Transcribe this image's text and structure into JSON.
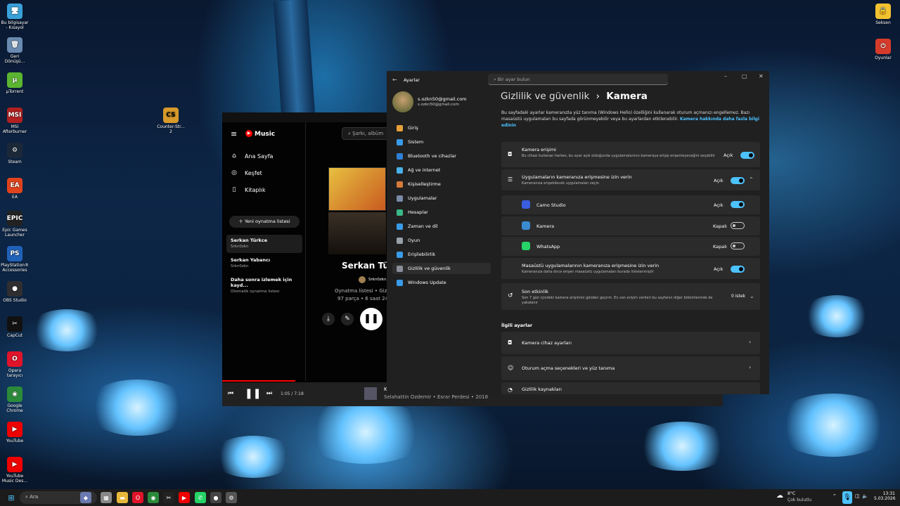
{
  "desktop": {
    "icons": [
      {
        "label": "Bu bilgisayar - Kısayol",
        "glyph": "🖥",
        "color": "#3aa0d8"
      },
      {
        "label": "Geri Dönüşü...",
        "glyph": "🗑",
        "color": "#6a8ab0"
      },
      {
        "label": "µTorrent",
        "glyph": "µ",
        "color": "#5bb531"
      },
      {
        "label": "MSI Afterburner",
        "glyph": "MSI",
        "color": "#b02020"
      },
      {
        "label": "Steam",
        "glyph": "⚙",
        "color": "#1b2838"
      },
      {
        "label": "EA",
        "glyph": "EA",
        "color": "#e0431c"
      },
      {
        "label": "Epic Games Launcher",
        "glyph": "EPIC",
        "color": "#222"
      },
      {
        "label": "PlayStation® Accessories",
        "glyph": "PS",
        "color": "#2062b8"
      },
      {
        "label": "OBS Studio",
        "glyph": "●",
        "color": "#302e31"
      },
      {
        "label": "CapCut",
        "glyph": "✂",
        "color": "#111"
      },
      {
        "label": "Opera tarayıcı",
        "glyph": "O",
        "color": "#e0132a"
      },
      {
        "label": "Google Chrome",
        "glyph": "◉",
        "color": "#2a8a3a"
      },
      {
        "label": "YouTube",
        "glyph": "▶",
        "color": "#e00"
      },
      {
        "label": "YouTube Music Des...",
        "glyph": "▶",
        "color": "#e00"
      }
    ],
    "cs_icon": {
      "label": "Counter-Str... 2",
      "glyph": "CS"
    },
    "right_icons": [
      {
        "label": "Seksen",
        "glyph": "🔒"
      },
      {
        "label": "Oyunlar",
        "glyph": "⏻"
      }
    ]
  },
  "music": {
    "app": "Music",
    "search_placeholder": "Şarkı, albüm",
    "nav": [
      {
        "label": "Ana Sayfa",
        "icon": "home-icon",
        "glyph": "⌂"
      },
      {
        "label": "Keşfet",
        "icon": "compass-icon",
        "glyph": "◎"
      },
      {
        "label": "Kitaplık",
        "icon": "library-icon",
        "glyph": "▯"
      }
    ],
    "new_playlist": "Yeni oynatma listesi",
    "playlists": [
      {
        "title": "Serkan Türkce",
        "sub": "Srkn0zkn"
      },
      {
        "title": "Serkan Yabancı",
        "sub": "Srkn0zkn"
      },
      {
        "title": "Daha sonra izlemek için kayd...",
        "sub": "Otomatik oynatma listesi"
      }
    ],
    "album_title": "Serkan Tür",
    "owner": "Srkn0zkn",
    "meta1": "Oynatma listesi • Giz",
    "meta2": "97 parça • 6 saat 24",
    "player_time": "1:05 / 7:18",
    "player_track": "Selahattin Özdemir • Esrar Perdesi • 2018",
    "player_track_short": "K"
  },
  "settings": {
    "window_title": "Ayarlar",
    "search_placeholder": "Bir ayar bulun",
    "user_email": "s.ozkn50@gmail.com",
    "user_email2": "s.ozkn50@gmail.com",
    "nav": [
      {
        "label": "Giriş",
        "color": "#e8a13a"
      },
      {
        "label": "Sistem",
        "color": "#3a9be8"
      },
      {
        "label": "Bluetooth ve cihazlar",
        "color": "#2f7fd6"
      },
      {
        "label": "Ağ ve internet",
        "color": "#4ab0e8"
      },
      {
        "label": "Kişiselleştirme",
        "color": "#d57a3a"
      },
      {
        "label": "Uygulamalar",
        "color": "#7a8aa8"
      },
      {
        "label": "Hesaplar",
        "color": "#3ab88a"
      },
      {
        "label": "Zaman ve dil",
        "color": "#3a9be8"
      },
      {
        "label": "Oyun",
        "color": "#9aa0aa"
      },
      {
        "label": "Erişilebilirlik",
        "color": "#3a9be8"
      },
      {
        "label": "Gizlilik ve güvenlik",
        "color": "#8a8f99"
      },
      {
        "label": "Windows Update",
        "color": "#3a9be8"
      }
    ],
    "breadcrumb_parent": "Gizlilik ve güvenlik",
    "breadcrumb_sep": "›",
    "breadcrumb_current": "Kamera",
    "description": "Bu sayfadaki ayarlar kameranızla yüz tanıma (Windows Hello) özelliğini kullanarak oturum açmanızı engellemez. Bazı masaüstü uygulamaları bu sayfada görünmeyebilir veya bu ayarlardan etkilenebilir.",
    "description_link": "Kamera hakkında daha fazla bilgi edinin",
    "camera_access": {
      "title": "Kamera erişimi",
      "sub": "Bu cihazı kullanan herkes, bu ayar açık olduğunda uygulamalarının kameraya erişip erişemeyeceğini seçebilir",
      "state": "Açık"
    },
    "apps_access": {
      "title": "Uygulamaların kameranıza erişmesine izin verin",
      "sub": "Kameranıza erişebilecek uygulamaları seçin",
      "state": "Açık"
    },
    "apps": [
      {
        "name": "Camo Studio",
        "state": "Açık",
        "on": true,
        "color": "#3a5de0"
      },
      {
        "name": "Kamera",
        "state": "Kapalı",
        "on": false,
        "color": "#3a8ad0"
      },
      {
        "name": "WhatsApp",
        "state": "Kapalı",
        "on": false,
        "color": "#25d366"
      }
    ],
    "desktop_access": {
      "title": "Masaüstü uygulamalarının kameranıza erişmesine izin verin",
      "sub": "Kameranıza daha önce erişen masaüstü uygulamaları burada listelenmiştir",
      "state": "Açık"
    },
    "recent": {
      "title": "Son etkinlik",
      "sub": "Son 7 gün içindeki kamera erişimini gözden geçirin. En son erişim verileri bu sayfanın diğer bölümlerinde de yakalanır",
      "count": "0 istek"
    },
    "related_header": "İlgili ayarlar",
    "related": [
      "Kamera cihaz ayarları",
      "Oturum açma seçenekleri ve yüz tanıma",
      "Gizlilik kaynakları"
    ]
  },
  "taskbar": {
    "search_placeholder": "Ara",
    "weather_temp": "8°C",
    "weather_text": "Çok bulutlu",
    "time": "13:31",
    "date": "5.03.2026"
  }
}
